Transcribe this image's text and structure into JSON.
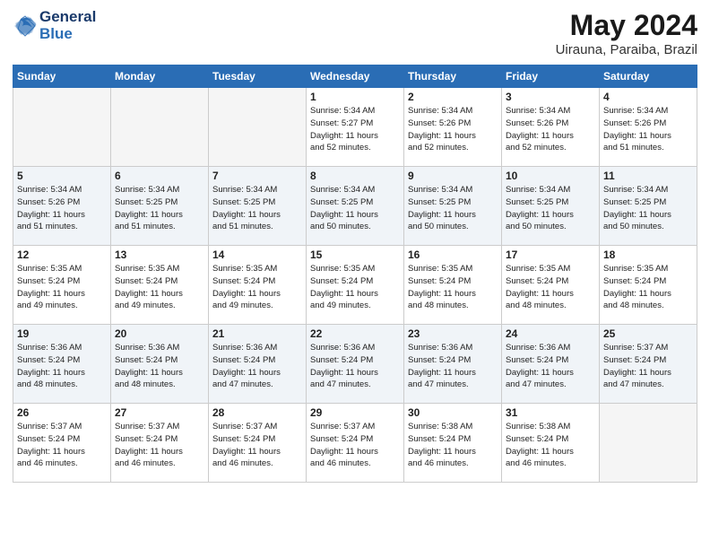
{
  "header": {
    "logo_line1": "General",
    "logo_line2": "Blue",
    "month": "May 2024",
    "location": "Uirauna, Paraiba, Brazil"
  },
  "weekdays": [
    "Sunday",
    "Monday",
    "Tuesday",
    "Wednesday",
    "Thursday",
    "Friday",
    "Saturday"
  ],
  "weeks": [
    [
      {
        "day": "",
        "info": ""
      },
      {
        "day": "",
        "info": ""
      },
      {
        "day": "",
        "info": ""
      },
      {
        "day": "1",
        "info": "Sunrise: 5:34 AM\nSunset: 5:27 PM\nDaylight: 11 hours\nand 52 minutes."
      },
      {
        "day": "2",
        "info": "Sunrise: 5:34 AM\nSunset: 5:26 PM\nDaylight: 11 hours\nand 52 minutes."
      },
      {
        "day": "3",
        "info": "Sunrise: 5:34 AM\nSunset: 5:26 PM\nDaylight: 11 hours\nand 52 minutes."
      },
      {
        "day": "4",
        "info": "Sunrise: 5:34 AM\nSunset: 5:26 PM\nDaylight: 11 hours\nand 51 minutes."
      }
    ],
    [
      {
        "day": "5",
        "info": "Sunrise: 5:34 AM\nSunset: 5:26 PM\nDaylight: 11 hours\nand 51 minutes."
      },
      {
        "day": "6",
        "info": "Sunrise: 5:34 AM\nSunset: 5:25 PM\nDaylight: 11 hours\nand 51 minutes."
      },
      {
        "day": "7",
        "info": "Sunrise: 5:34 AM\nSunset: 5:25 PM\nDaylight: 11 hours\nand 51 minutes."
      },
      {
        "day": "8",
        "info": "Sunrise: 5:34 AM\nSunset: 5:25 PM\nDaylight: 11 hours\nand 50 minutes."
      },
      {
        "day": "9",
        "info": "Sunrise: 5:34 AM\nSunset: 5:25 PM\nDaylight: 11 hours\nand 50 minutes."
      },
      {
        "day": "10",
        "info": "Sunrise: 5:34 AM\nSunset: 5:25 PM\nDaylight: 11 hours\nand 50 minutes."
      },
      {
        "day": "11",
        "info": "Sunrise: 5:34 AM\nSunset: 5:25 PM\nDaylight: 11 hours\nand 50 minutes."
      }
    ],
    [
      {
        "day": "12",
        "info": "Sunrise: 5:35 AM\nSunset: 5:24 PM\nDaylight: 11 hours\nand 49 minutes."
      },
      {
        "day": "13",
        "info": "Sunrise: 5:35 AM\nSunset: 5:24 PM\nDaylight: 11 hours\nand 49 minutes."
      },
      {
        "day": "14",
        "info": "Sunrise: 5:35 AM\nSunset: 5:24 PM\nDaylight: 11 hours\nand 49 minutes."
      },
      {
        "day": "15",
        "info": "Sunrise: 5:35 AM\nSunset: 5:24 PM\nDaylight: 11 hours\nand 49 minutes."
      },
      {
        "day": "16",
        "info": "Sunrise: 5:35 AM\nSunset: 5:24 PM\nDaylight: 11 hours\nand 48 minutes."
      },
      {
        "day": "17",
        "info": "Sunrise: 5:35 AM\nSunset: 5:24 PM\nDaylight: 11 hours\nand 48 minutes."
      },
      {
        "day": "18",
        "info": "Sunrise: 5:35 AM\nSunset: 5:24 PM\nDaylight: 11 hours\nand 48 minutes."
      }
    ],
    [
      {
        "day": "19",
        "info": "Sunrise: 5:36 AM\nSunset: 5:24 PM\nDaylight: 11 hours\nand 48 minutes."
      },
      {
        "day": "20",
        "info": "Sunrise: 5:36 AM\nSunset: 5:24 PM\nDaylight: 11 hours\nand 48 minutes."
      },
      {
        "day": "21",
        "info": "Sunrise: 5:36 AM\nSunset: 5:24 PM\nDaylight: 11 hours\nand 47 minutes."
      },
      {
        "day": "22",
        "info": "Sunrise: 5:36 AM\nSunset: 5:24 PM\nDaylight: 11 hours\nand 47 minutes."
      },
      {
        "day": "23",
        "info": "Sunrise: 5:36 AM\nSunset: 5:24 PM\nDaylight: 11 hours\nand 47 minutes."
      },
      {
        "day": "24",
        "info": "Sunrise: 5:36 AM\nSunset: 5:24 PM\nDaylight: 11 hours\nand 47 minutes."
      },
      {
        "day": "25",
        "info": "Sunrise: 5:37 AM\nSunset: 5:24 PM\nDaylight: 11 hours\nand 47 minutes."
      }
    ],
    [
      {
        "day": "26",
        "info": "Sunrise: 5:37 AM\nSunset: 5:24 PM\nDaylight: 11 hours\nand 46 minutes."
      },
      {
        "day": "27",
        "info": "Sunrise: 5:37 AM\nSunset: 5:24 PM\nDaylight: 11 hours\nand 46 minutes."
      },
      {
        "day": "28",
        "info": "Sunrise: 5:37 AM\nSunset: 5:24 PM\nDaylight: 11 hours\nand 46 minutes."
      },
      {
        "day": "29",
        "info": "Sunrise: 5:37 AM\nSunset: 5:24 PM\nDaylight: 11 hours\nand 46 minutes."
      },
      {
        "day": "30",
        "info": "Sunrise: 5:38 AM\nSunset: 5:24 PM\nDaylight: 11 hours\nand 46 minutes."
      },
      {
        "day": "31",
        "info": "Sunrise: 5:38 AM\nSunset: 5:24 PM\nDaylight: 11 hours\nand 46 minutes."
      },
      {
        "day": "",
        "info": ""
      }
    ]
  ]
}
